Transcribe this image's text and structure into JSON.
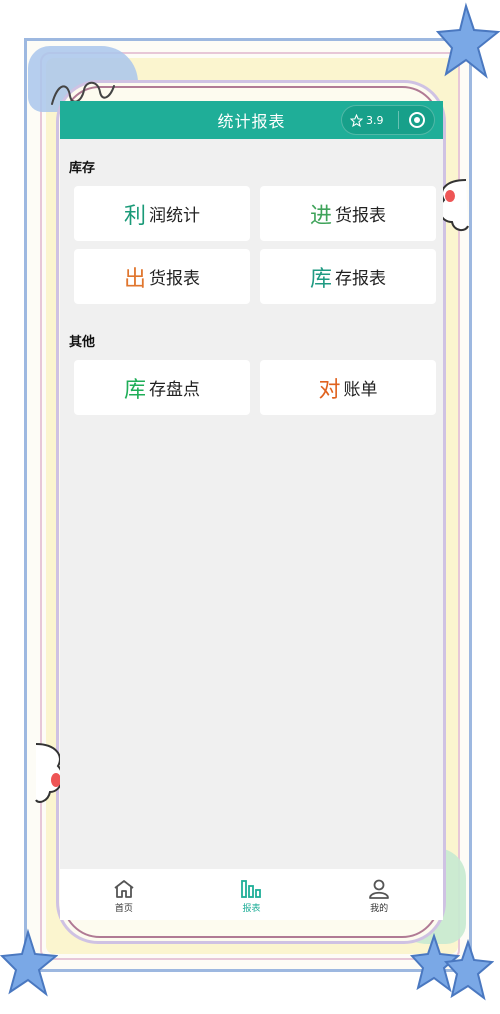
{
  "navbar": {
    "title": "统计报表",
    "capsule_text": "3.9",
    "accent": "#1fae98"
  },
  "sections": [
    {
      "title": "库存",
      "cards": [
        {
          "big": "利",
          "rest": "润统计",
          "big_color": "#1a9a78"
        },
        {
          "big": "进",
          "rest": "货报表",
          "big_color": "#3fa35a"
        },
        {
          "big": "出",
          "rest": "货报表",
          "big_color": "#e0762e"
        },
        {
          "big": "库",
          "rest": "存报表",
          "big_color": "#1f9a82"
        }
      ]
    },
    {
      "title": "其他",
      "cards": [
        {
          "big": "库",
          "rest": "存盘点",
          "big_color": "#1fae58"
        },
        {
          "big": "对",
          "rest": "账单",
          "big_color": "#e0621e"
        }
      ]
    }
  ],
  "tabbar": {
    "tabs": [
      {
        "label": "首页",
        "icon": "home-icon",
        "active": false
      },
      {
        "label": "报表",
        "icon": "report-icon",
        "active": true
      },
      {
        "label": "我的",
        "icon": "user-icon",
        "active": false
      }
    ],
    "active_color": "#1fae98",
    "inactive_color": "#555555"
  }
}
